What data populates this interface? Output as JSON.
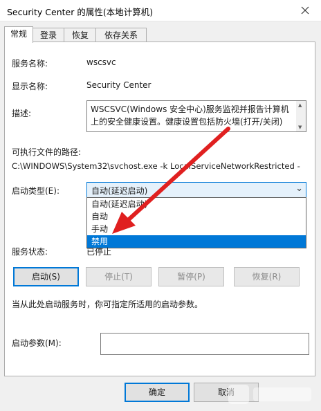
{
  "window": {
    "title": "Security Center 的属性(本地计算机)"
  },
  "tabs": [
    "常规",
    "登录",
    "恢复",
    "依存关系"
  ],
  "general": {
    "service_name_label": "服务名称:",
    "service_name_value": "wscsvc",
    "display_name_label": "显示名称:",
    "display_name_value": "Security Center",
    "description_label": "描述:",
    "description_line1": "WSCSVC(Windows 安全中心)服务监视并报告计算机",
    "description_line2": "上的安全健康设置。健康设置包括防火墙(打开/关闭)",
    "exe_path_label": "可执行文件的路径:",
    "exe_path_value": "C:\\WINDOWS\\System32\\svchost.exe -k LocalServiceNetworkRestricted -",
    "startup_type_label": "启动类型(E):",
    "startup_type_value": "自动(延迟启动)",
    "startup_options": [
      "自动(延迟启动)",
      "自动",
      "手动",
      "禁用"
    ],
    "highlighted_option": "禁用",
    "service_status_label": "服务状态:",
    "service_status_value": "已停止",
    "buttons": {
      "start": "启动(S)",
      "stop": "停止(T)",
      "pause": "暂停(P)",
      "resume": "恢复(R)"
    },
    "hint_text": "当从此处启动服务时，你可指定所适用的启动参数。",
    "start_params_label": "启动参数(M):",
    "start_params_value": ""
  },
  "footer": {
    "ok": "确定",
    "cancel": "取消"
  },
  "annotation": {
    "arrow_color": "#e02020"
  },
  "colors": {
    "accent": "#0078d7",
    "panel": "#ffffff",
    "window": "#f0f0f0"
  }
}
